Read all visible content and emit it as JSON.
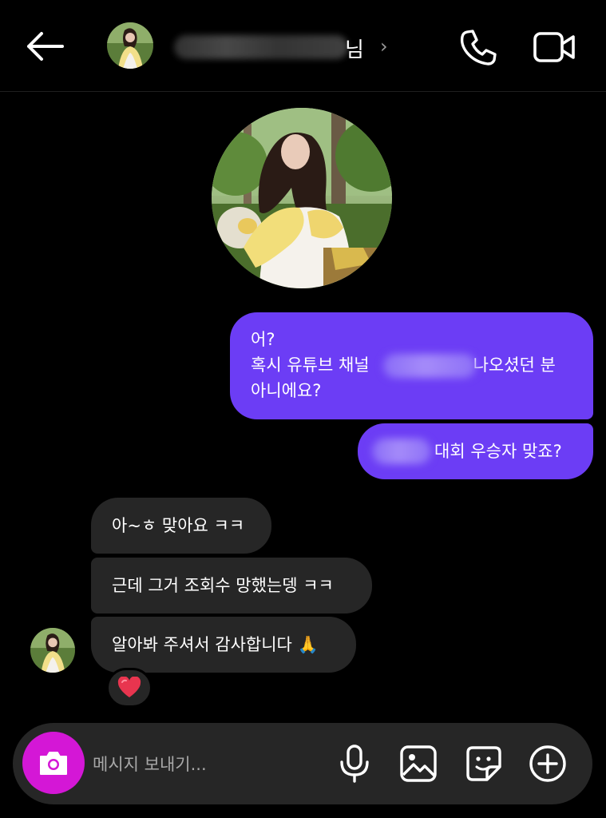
{
  "header": {
    "name_suffix": "님",
    "chevron": "›",
    "icons": [
      "back-arrow-icon",
      "phone-icon",
      "video-camera-icon"
    ]
  },
  "messages": [
    {
      "dir": "out",
      "lines": [
        "어?",
        "혹시 유튜브 채널",
        "나오셨던 분",
        "아니에요?"
      ]
    },
    {
      "dir": "out",
      "text": "대회 우승자 맞죠?"
    },
    {
      "dir": "in",
      "text": "아~ㅎ 맞아요 ㅋㅋ"
    },
    {
      "dir": "in",
      "text": "근데 그거 조회수 망했는뎅 ㅋㅋ"
    },
    {
      "dir": "in",
      "text": "알아봐 주셔서 감사합니다 🙏"
    }
  ],
  "reaction": "❤️",
  "composer": {
    "placeholder": "메시지 보내기...",
    "icons": [
      "camera-icon",
      "microphone-icon",
      "image-icon",
      "sticker-icon",
      "plus-circle-icon"
    ]
  },
  "colors": {
    "background": "#000000",
    "outgoing_bubble": "#6c3df5",
    "incoming_bubble": "#262626",
    "camera_button": "#d417d6"
  }
}
